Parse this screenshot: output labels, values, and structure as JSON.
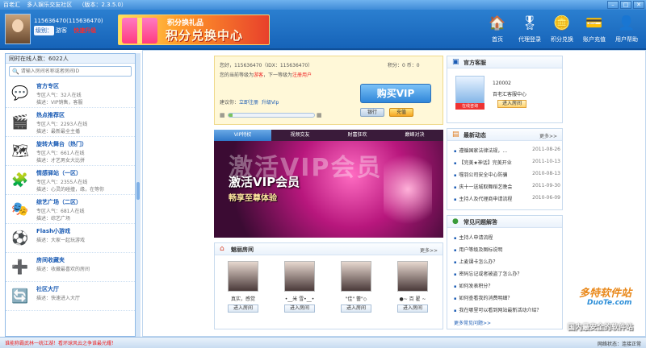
{
  "window": {
    "title_parts": [
      "百老汇",
      "多人娱乐交友社区",
      "（版本：2.3.5.0）"
    ],
    "buttons": [
      "–",
      "□",
      "✕"
    ]
  },
  "header": {
    "user": "115636470(115636470)",
    "level_label": "级别：",
    "level_value": "游客",
    "upgrade": "快速升级",
    "banner_line1": "积分换礼品",
    "banner_line2": "积分兑换中心",
    "nav": [
      {
        "label": "首页",
        "icon": "home-icon",
        "glyph": "🏠"
      },
      {
        "label": "代理登录",
        "icon": "agent-icon",
        "glyph": "🎖"
      },
      {
        "label": "积分兑换",
        "icon": "coins-icon",
        "glyph": "🪙"
      },
      {
        "label": "账户充值",
        "icon": "recharge-icon",
        "glyph": "💳"
      },
      {
        "label": "用户帮助",
        "icon": "help-icon",
        "glyph": "👤"
      }
    ]
  },
  "left": {
    "online": "同时在线人数：6022人",
    "search_placeholder": "请输入房间名称或者房间ID",
    "rooms": [
      {
        "title": "官方专区",
        "l1": "专区人气：32人在线",
        "l2": "描述：VIP销售，客服",
        "icon": "chat-icon",
        "glyph": "💬"
      },
      {
        "title": "热点推荐区",
        "l1": "专区人气：2293人在线",
        "l2": "描述：最新最全主播",
        "icon": "film-icon",
        "glyph": "🎬"
      },
      {
        "title": "旋转大舞台（热门）",
        "l1": "专区人气：661人在线",
        "l2": "描述：才艺男女大比拼",
        "icon": "stage-icon",
        "glyph": "🗺"
      },
      {
        "title": "情感驿站（一区）",
        "l1": "专区人气：2355人在线",
        "l2": "描述：心灵的碰撞，缘，在等你",
        "icon": "heart-chat-icon",
        "glyph": "🧩"
      },
      {
        "title": "综艺广场（二区）",
        "l1": "专区人气：681人在线",
        "l2": "描述：综艺广场",
        "icon": "variety-icon",
        "glyph": "🎭"
      },
      {
        "title": "Flash小游戏",
        "l1": "描述：大家一起玩游戏",
        "l2": "",
        "icon": "game-icon",
        "glyph": "⚽"
      },
      {
        "title": "房间收藏夹",
        "l1": "描述：收藏最喜欢的房间",
        "l2": "",
        "icon": "favorite-icon",
        "glyph": "➕"
      },
      {
        "title": "社区大厅",
        "l1": "描述：快速进入大厅",
        "l2": "",
        "icon": "hall-icon",
        "glyph": "🔄"
      }
    ]
  },
  "vip": {
    "greeting": "您好，115636470（IDX：115636470）",
    "points": "积分：0  币：0",
    "level_line_a": "您的当前等级为",
    "level_line_b": "游客",
    "level_line_c": "，下一等级为",
    "level_line_d": "注册用户",
    "suggest_a": "建议你：",
    "suggest_b": "立即注册",
    "suggest_c": "升级Vip",
    "progress": 0.05,
    "buy": "购买VIP",
    "bank": "银行",
    "recharge": "充值"
  },
  "tabs": [
    "VIP特权",
    "视频交友",
    "财富狂欢",
    "巅峰对决"
  ],
  "promo": {
    "ghost": "激活VIP会员",
    "line1": "激活VIP会员",
    "line2": "畅享至尊体验"
  },
  "rooms_box": {
    "title": "魅丽房间",
    "more": "更多>>",
    "items": [
      {
        "name": "真实，感觉",
        "btn": "进入房间"
      },
      {
        "name": "•__米 雪•__•",
        "btn": "进入房间"
      },
      {
        "name": "\"佳\" 蕾\"◇",
        "btn": "进入房间"
      },
      {
        "name": "●~ 百 翟 ~",
        "btn": "进入房间"
      }
    ]
  },
  "service": {
    "title": "官方客服",
    "qq": "120002",
    "name": "百老汇客服中心",
    "badge": "在线咨询",
    "enter": "进入房间"
  },
  "news": {
    "title": "最新动态",
    "more": "更多>>",
    "items": [
      {
        "text": "遵循国家法律法规，...",
        "date": "2011-08-26"
      },
      {
        "text": "【完美★神话】完美开业",
        "date": "2011-10-13"
      },
      {
        "text": "噬羽公司安全中心防骗",
        "date": "2010-08-13"
      },
      {
        "text": "庆十一送城取舞蹈艺晚会",
        "date": "2011-09-30"
      },
      {
        "text": "主持人及代理商申请流程",
        "date": "2010-06-09"
      }
    ]
  },
  "faq": {
    "title": "常见问题解答",
    "items": [
      "主持人申请流程",
      "用户等级及图标说明",
      "上麦课卡怎么办？",
      "密码忘记或者被盗了怎么办？",
      "如何发表积分？",
      "如何查看我的消费明细？",
      "我在哪里可以看到网站最新活动介绍？"
    ],
    "more": "更多常见问题>>"
  },
  "watermark": {
    "w1": "多特软件站",
    "w2": "DuoTe.com",
    "w3": "国内最安全的软件站"
  },
  "status": {
    "message": "谁能称霸武林一统江湖！看环球风云之争谁最光耀！",
    "network": "网络状态：连接正常"
  }
}
